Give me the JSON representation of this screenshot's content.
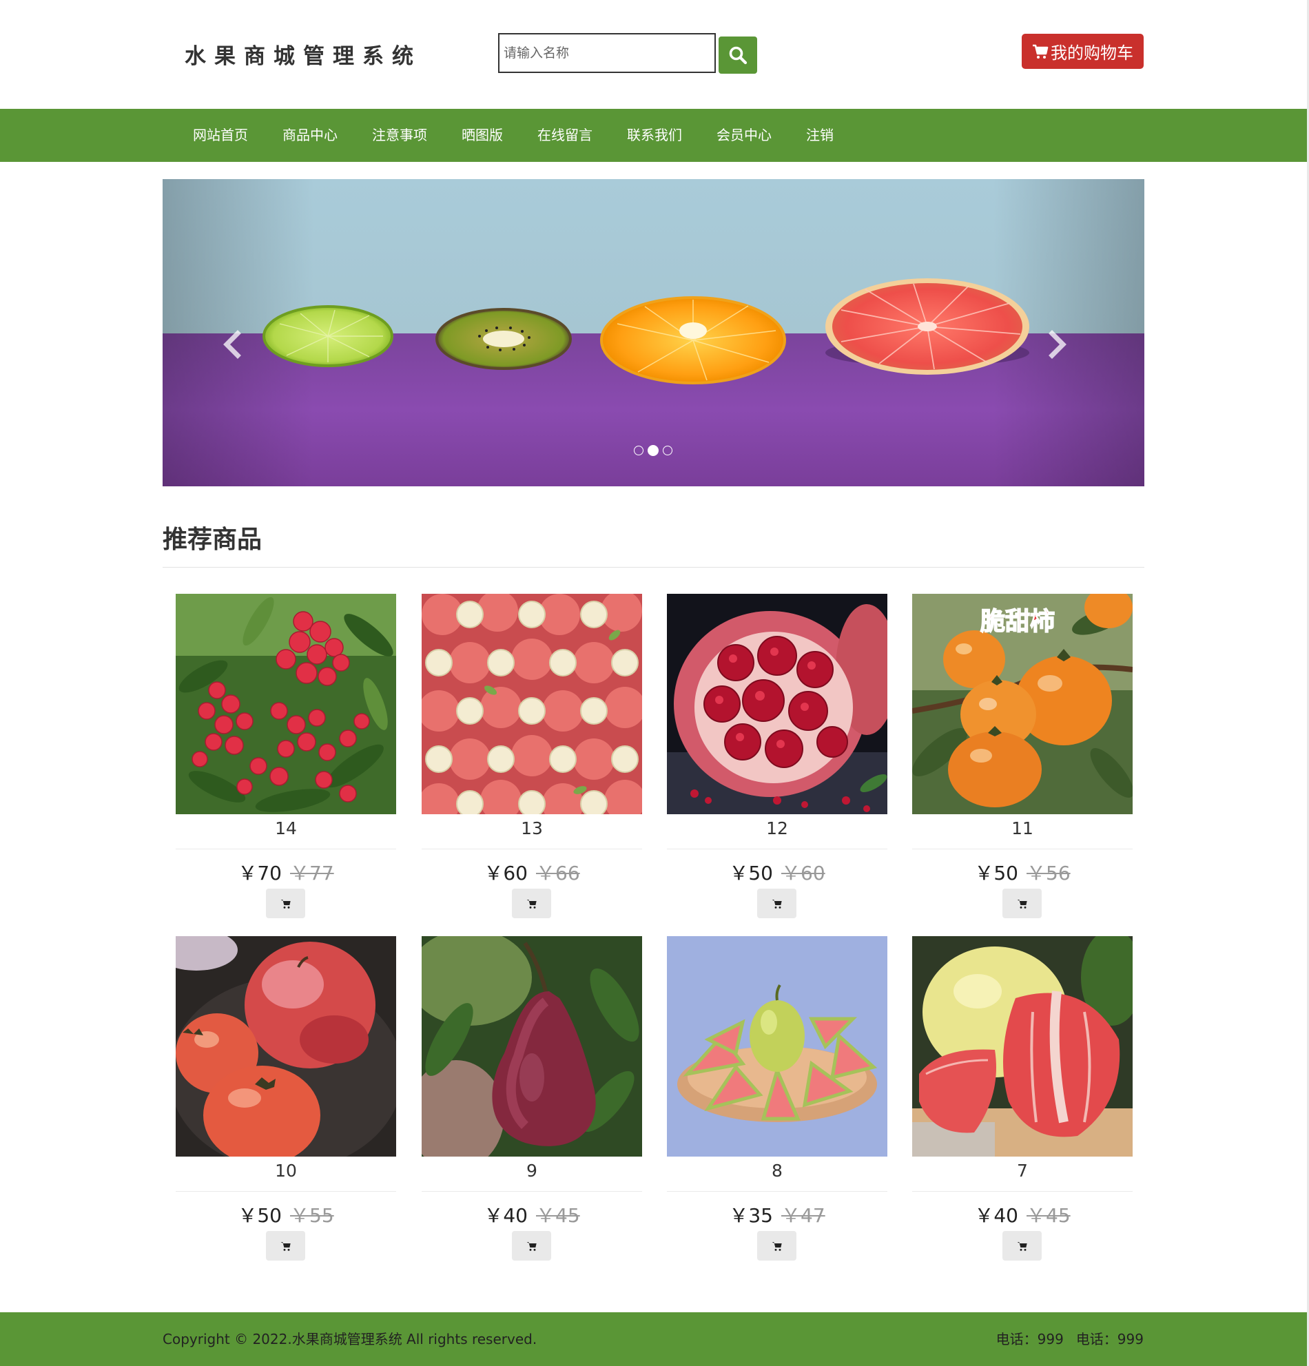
{
  "header": {
    "site_title": "水果商城管理系统",
    "search_placeholder": "请输入名称",
    "cart_label": "我的购物车"
  },
  "nav": {
    "items": [
      "网站首页",
      "商品中心",
      "注意事项",
      "晒图版",
      "在线留言",
      "联系我们",
      "会员中心",
      "注销"
    ]
  },
  "carousel": {
    "slide_count": 3,
    "active_index": 1
  },
  "section": {
    "title": "推荐商品"
  },
  "currency": "￥",
  "products": [
    {
      "name": "14",
      "price": "70",
      "old_price": "77",
      "image": "lychee-cluster"
    },
    {
      "name": "13",
      "price": "60",
      "old_price": "66",
      "image": "strawberry-tart"
    },
    {
      "name": "12",
      "price": "50",
      "old_price": "60",
      "image": "pomegranate"
    },
    {
      "name": "11",
      "price": "50",
      "old_price": "56",
      "image": "persimmon",
      "image_caption": "脆甜柿"
    },
    {
      "name": "10",
      "price": "50",
      "old_price": "55",
      "image": "apple-tomato"
    },
    {
      "name": "9",
      "price": "40",
      "old_price": "45",
      "image": "red-pear"
    },
    {
      "name": "8",
      "price": "35",
      "old_price": "47",
      "image": "guava-plate"
    },
    {
      "name": "7",
      "price": "40",
      "old_price": "45",
      "image": "pomelo"
    }
  ],
  "footer": {
    "copyright": "Copyright © 2022.水果商城管理系统 All rights reserved.",
    "phone1": "电话：999",
    "phone2": "电话：999"
  },
  "colors": {
    "brand_green": "#5a9636",
    "cart_red": "#c9302c"
  }
}
